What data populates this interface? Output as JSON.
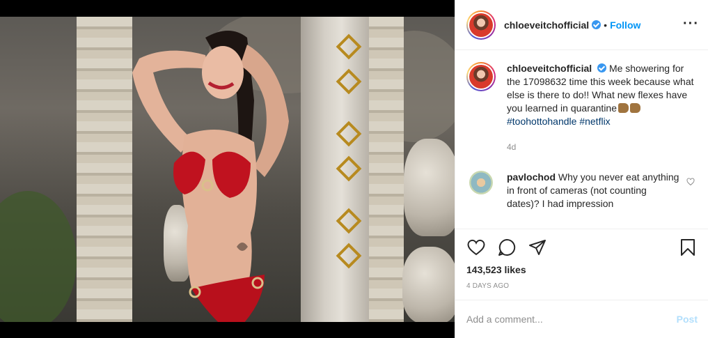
{
  "post": {
    "username": "chloeveitchofficial",
    "follow_label": "Follow",
    "separator": "•",
    "more_icon": "more-horizontal-icon",
    "verified_icon": "verified-badge-icon"
  },
  "caption": {
    "username": "chloeveitchofficial",
    "text_part1": "Me showering for the 17098632 time this week because what else is there to do!! What new flexes have you learned in quarantine",
    "emoji": "flexed-biceps-emoji",
    "hashtag1": "#toohottohandle",
    "hashtag2": "#netflix",
    "time": "4d"
  },
  "comments": [
    {
      "username": "pavlochod",
      "text": "Why you never eat anything in front of cameras (not counting dates)? I had impression"
    }
  ],
  "actions": {
    "likes": "143,523 likes",
    "date": "4 DAYS AGO"
  },
  "add_comment": {
    "placeholder": "Add a comment...",
    "post_label": "Post"
  },
  "colors": {
    "accent": "#0095f6",
    "hashtag": "#00376b",
    "muted": "#8e8e8e",
    "post_disabled": "#b2dffc"
  }
}
